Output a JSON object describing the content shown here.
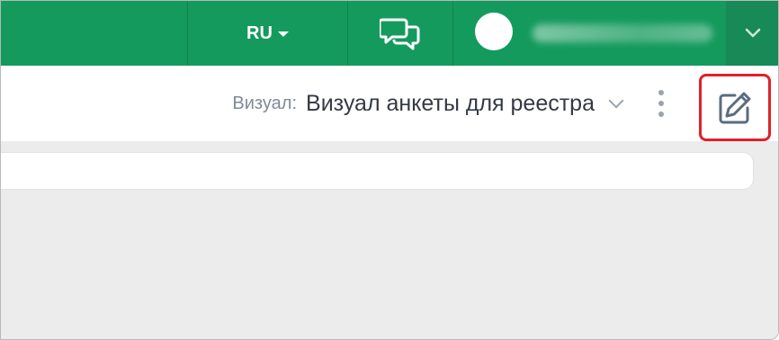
{
  "header": {
    "language": "RU",
    "chat_icon": "chat-bubbles-icon",
    "user_menu_icon": "chevron-down-icon"
  },
  "toolbar": {
    "visual_label": "Визуал:",
    "visual_value": "Визуал анкеты для реестра",
    "more_icon": "kebab-menu-icon",
    "edit_icon": "edit-pencil-icon"
  },
  "colors": {
    "brand_green": "#149a5d",
    "highlight_red": "#e2202a"
  }
}
